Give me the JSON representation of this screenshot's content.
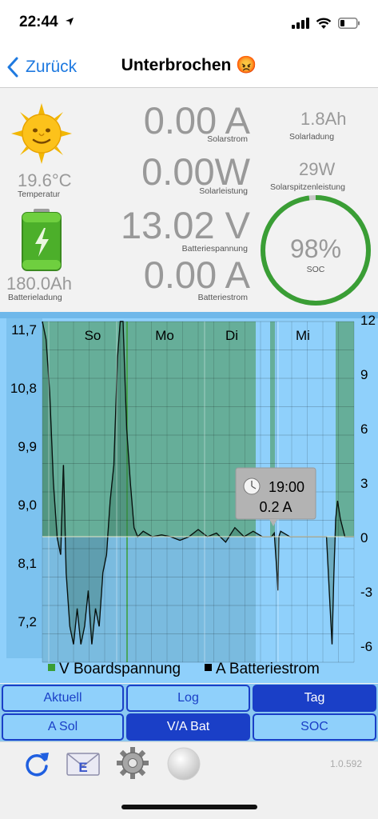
{
  "status": {
    "time": "22:44"
  },
  "nav": {
    "back_label": "Zurück",
    "title": "Unterbrochen 😡"
  },
  "dashboard": {
    "temperature": {
      "value": "19.6°C",
      "caption": "Temperatur"
    },
    "battery_charge": {
      "value": "180.0Ah",
      "caption": "Batterieladung"
    },
    "solar_current": {
      "value": "0.00 A",
      "caption": "Solarstrom"
    },
    "solar_power": {
      "value": "0.00W",
      "caption": "Solarleistung"
    },
    "battery_voltage": {
      "value": "13.02 V",
      "caption": "Batteriespannung"
    },
    "battery_current": {
      "value": "0.00 A",
      "caption": "Batteriestrom"
    },
    "solar_charge": {
      "value": "1.8Ah",
      "caption": "Solarladung"
    },
    "solar_peak": {
      "value": "29W",
      "caption": "Solarspitzenleistung"
    },
    "soc": {
      "value": "98%",
      "caption": "SOC",
      "fraction": 0.98
    },
    "colors": {
      "soc_ring": "#3a9e35",
      "soc_track": "#c8c8c8"
    }
  },
  "chart_data": {
    "type": "line",
    "days": [
      "So",
      "Mo",
      "Di",
      "Mi"
    ],
    "left_axis": {
      "ticks": [
        "11,7",
        "10,8",
        "9,9",
        "9,0",
        "8,1",
        "7,2"
      ],
      "range": [
        6.3,
        11.7
      ]
    },
    "right_axis": {
      "ticks": [
        "12",
        "9",
        "6",
        "3",
        "0",
        "-3",
        "-6"
      ],
      "range": [
        -7,
        12
      ]
    },
    "series": [
      {
        "name": "V Boardspannung",
        "color": "#3a9e35"
      },
      {
        "name": "A Batteriestrom",
        "color": "#000000"
      }
    ],
    "current_points": [
      [
        0,
        12
      ],
      [
        0.4,
        11
      ],
      [
        0.8,
        8
      ],
      [
        1.2,
        3
      ],
      [
        1.6,
        0
      ],
      [
        2,
        -1
      ],
      [
        2.3,
        4
      ],
      [
        2.6,
        -2
      ],
      [
        3,
        -5
      ],
      [
        3.4,
        -6
      ],
      [
        3.8,
        -4
      ],
      [
        4.2,
        -6
      ],
      [
        4.6,
        -5
      ],
      [
        5,
        -3
      ],
      [
        5.4,
        -6
      ],
      [
        5.8,
        -4
      ],
      [
        6.2,
        -5
      ],
      [
        6.6,
        -2
      ],
      [
        7,
        -1
      ],
      [
        7.4,
        2
      ],
      [
        7.8,
        4
      ],
      [
        8.2,
        10
      ],
      [
        8.5,
        12
      ],
      [
        8.8,
        12
      ],
      [
        9.2,
        6
      ],
      [
        9.6,
        3
      ],
      [
        10,
        0.5
      ],
      [
        10.4,
        0
      ],
      [
        11,
        0.3
      ],
      [
        12,
        0
      ],
      [
        13,
        0.1
      ],
      [
        14,
        0
      ],
      [
        15,
        -0.2
      ],
      [
        16,
        0
      ],
      [
        17,
        0.4
      ],
      [
        18,
        0
      ],
      [
        19,
        0.2
      ],
      [
        20,
        -0.3
      ],
      [
        21,
        0.5
      ],
      [
        22,
        0
      ],
      [
        23,
        0.3
      ],
      [
        24,
        0
      ],
      [
        25,
        0
      ],
      [
        25.3,
        0.2
      ],
      [
        25.6,
        -2
      ],
      [
        25.7,
        -3
      ],
      [
        25.8,
        0
      ],
      [
        26,
        0.3
      ],
      [
        27,
        0
      ],
      [
        28,
        0
      ],
      [
        29,
        0
      ],
      [
        30,
        0
      ],
      [
        31,
        0
      ],
      [
        31.3,
        -3
      ],
      [
        31.6,
        -6
      ],
      [
        31.8,
        -2
      ],
      [
        32,
        1
      ],
      [
        32.2,
        2
      ],
      [
        32.5,
        1
      ],
      [
        33,
        0
      ],
      [
        34,
        0
      ]
    ],
    "voltage_range_days": [
      0,
      24
    ],
    "tooltip": {
      "time": "19:00",
      "value": "0.2 A"
    }
  },
  "tabs": {
    "row1": [
      {
        "label": "Aktuell",
        "active": false
      },
      {
        "label": "Log",
        "active": false
      },
      {
        "label": "Tag",
        "active": true
      }
    ],
    "row2": [
      {
        "label": "A Sol",
        "active": false
      },
      {
        "label": "V/A Bat",
        "active": true
      },
      {
        "label": "SOC",
        "active": false
      }
    ]
  },
  "toolbar": {
    "icons": [
      "refresh-icon",
      "mail-icon",
      "settings-icon",
      "status-light-icon"
    ],
    "version": "1.0.592"
  },
  "theme": {
    "accent": "#1f7ae0",
    "tab_active": "#1a3fc7",
    "chart_bg": "#8fd0fb"
  }
}
